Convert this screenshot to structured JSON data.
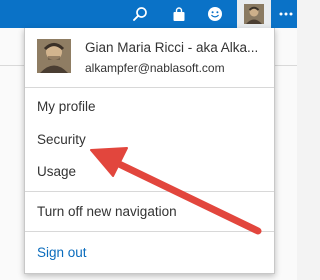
{
  "topbar": {
    "background": "#0a72c7",
    "icons": [
      "search-icon",
      "shopping-bag-icon",
      "smiley-icon",
      "avatar",
      "more-icon"
    ]
  },
  "account_menu": {
    "display_name": "Gian Maria Ricci - aka Alka...",
    "email": "alkampfer@nablasoft.com",
    "items": [
      {
        "label": "My profile"
      },
      {
        "label": "Security"
      },
      {
        "label": "Usage"
      }
    ],
    "navigation_toggle": "Turn off new navigation",
    "sign_out": "Sign out",
    "link_color": "#0a6cbd"
  },
  "annotation": {
    "type": "arrow",
    "color": "#e2463d",
    "points_to": "Security"
  }
}
